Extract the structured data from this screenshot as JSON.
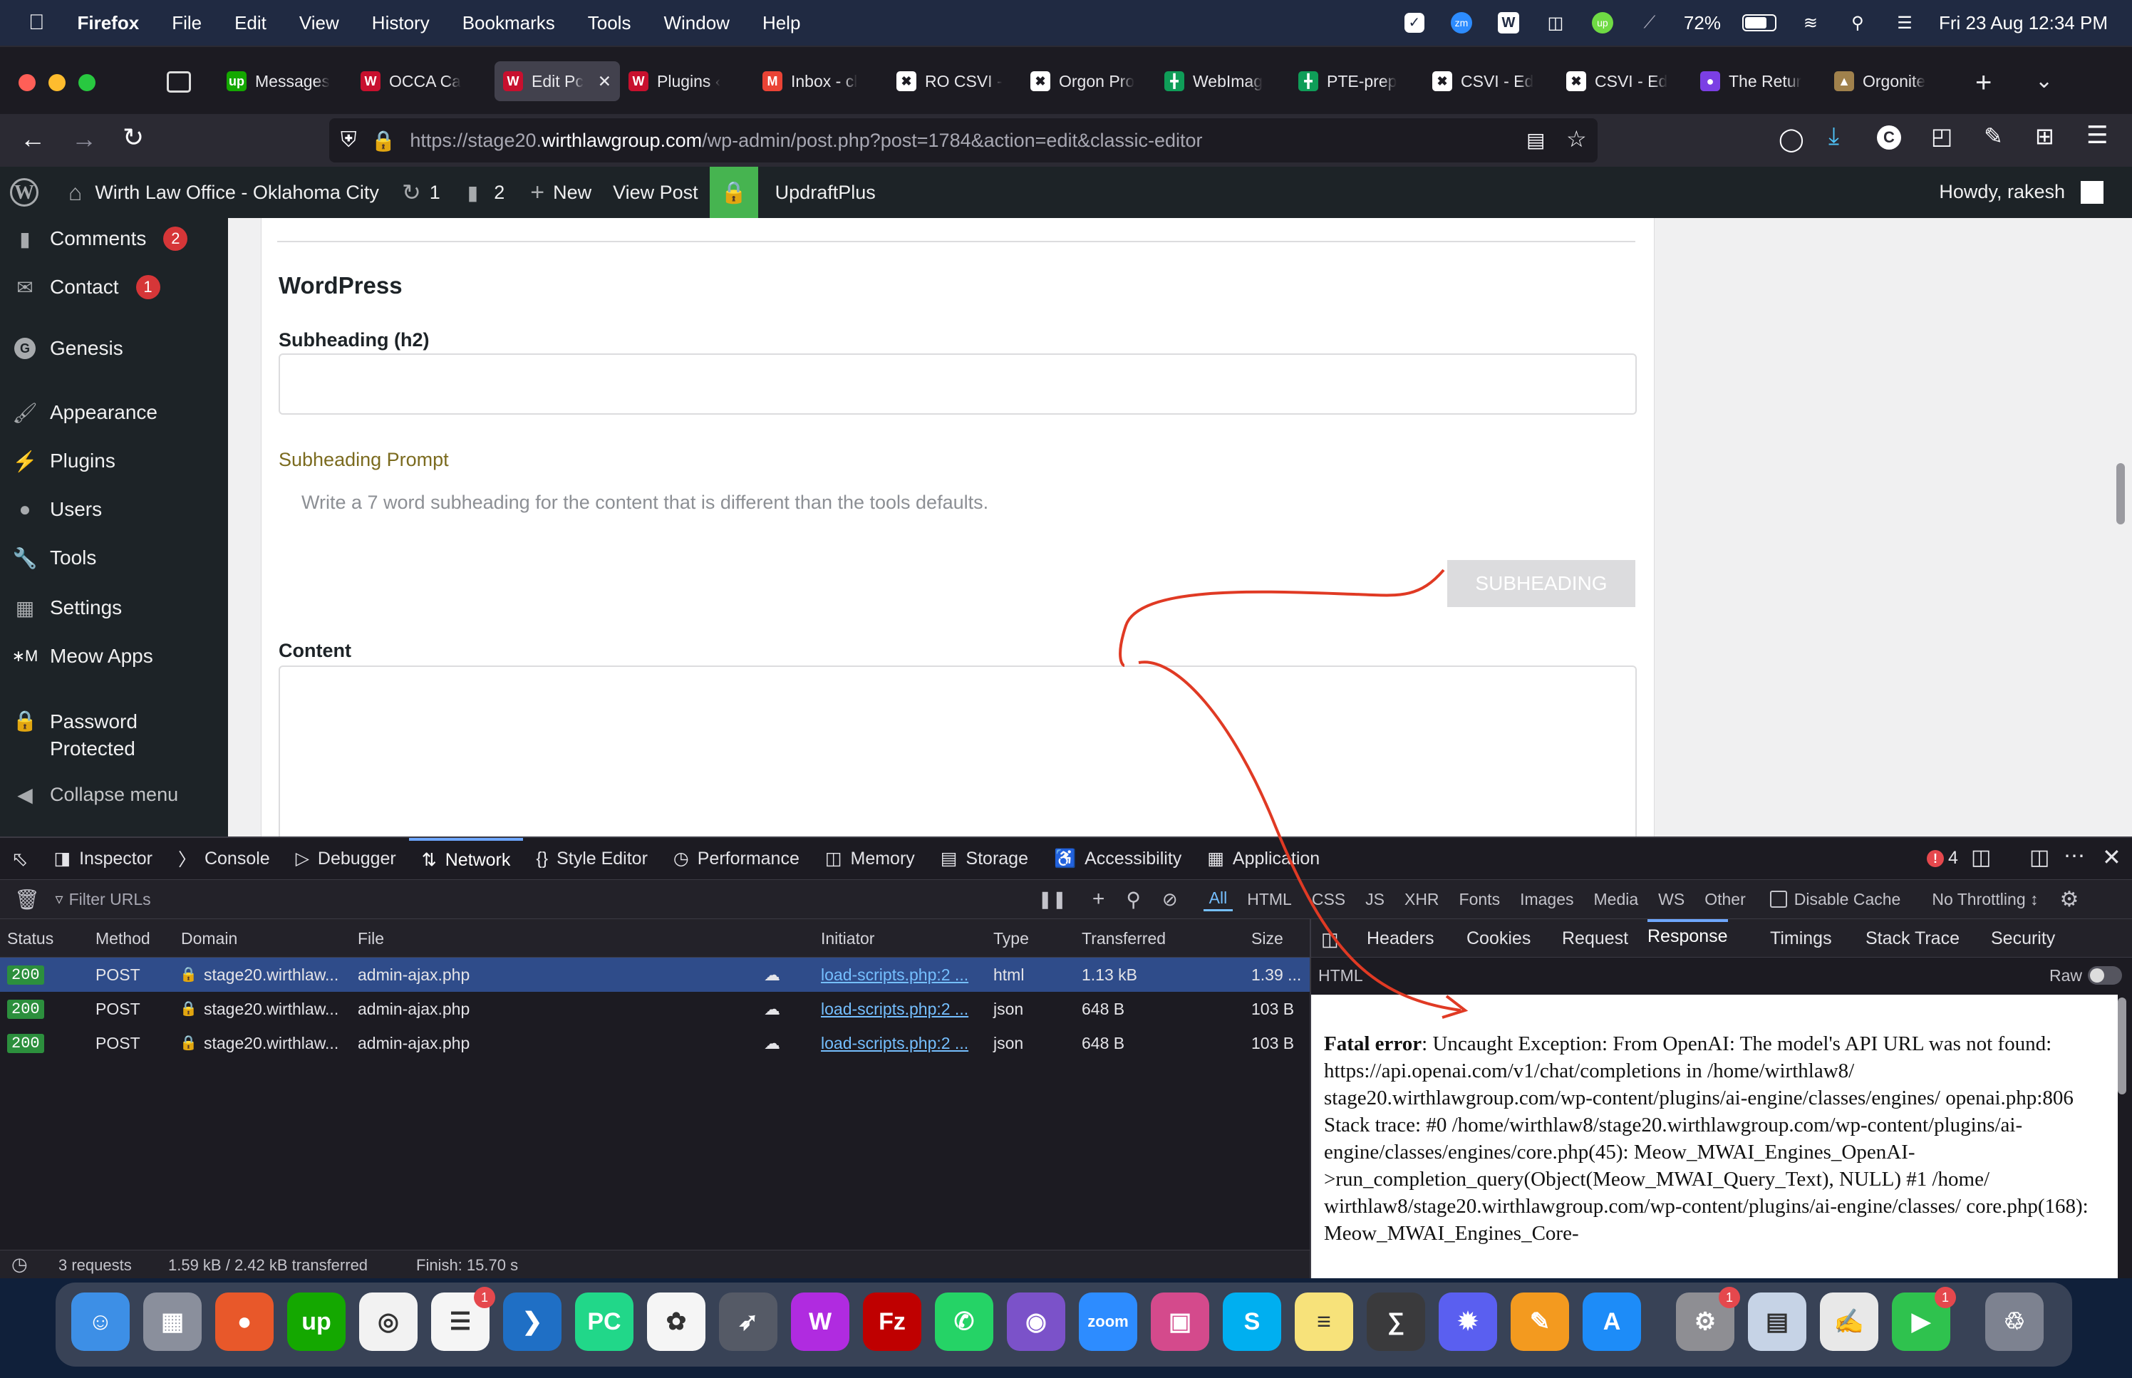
{
  "menubar": {
    "app_name": "Firefox",
    "items": [
      "File",
      "Edit",
      "View",
      "History",
      "Bookmarks",
      "Tools",
      "Window",
      "Help"
    ],
    "battery": "72%",
    "datetime": "Fri 23 Aug  12:34 PM"
  },
  "tabs": [
    {
      "label": "Messages",
      "favicon": "upwork-icon",
      "color": "#14a800",
      "glyph": "up"
    },
    {
      "label": "OCCA Ca",
      "favicon": "wirth-icon",
      "color": "#c8102e",
      "glyph": "W"
    },
    {
      "label": "Edit Pc",
      "favicon": "wirth-icon",
      "color": "#c8102e",
      "glyph": "W",
      "active": true
    },
    {
      "label": "Plugins ‹",
      "favicon": "wirth-icon",
      "color": "#c8102e",
      "glyph": "W"
    },
    {
      "label": "Inbox - cl",
      "favicon": "gmail-icon",
      "color": "#ea4335",
      "glyph": "M"
    },
    {
      "label": "RO CSVI -",
      "favicon": "joomla-icon",
      "color": "#ffffff",
      "glyph": "✖"
    },
    {
      "label": "Orgon Pro",
      "favicon": "joomla-icon",
      "color": "#ffffff",
      "glyph": "✖"
    },
    {
      "label": "WebImag",
      "favicon": "sheets-icon",
      "color": "#0f9d58",
      "glyph": "╋"
    },
    {
      "label": "PTE-prep",
      "favicon": "sheets-icon",
      "color": "#0f9d58",
      "glyph": "╋"
    },
    {
      "label": "CSVI - Ed",
      "favicon": "joomla-icon",
      "color": "#ffffff",
      "glyph": "✖"
    },
    {
      "label": "CSVI - Ed",
      "favicon": "joomla-icon",
      "color": "#ffffff",
      "glyph": "✖"
    },
    {
      "label": "The Retur",
      "favicon": "podcast-icon",
      "color": "#7b3fe4",
      "glyph": "●"
    },
    {
      "label": "Orgonite",
      "favicon": "pyramid-icon",
      "color": "#a0814c",
      "glyph": "▲"
    }
  ],
  "url": {
    "prefix": "https://stage20.",
    "host": "wirthlawgroup.com",
    "path": "/wp-admin/post.php?post=1784&action=edit&classic-editor"
  },
  "wpbar": {
    "site_name": "Wirth Law Office - Oklahoma City",
    "updates": "1",
    "comments": "2",
    "new": "New",
    "view_post": "View Post",
    "updraft": "UpdraftPlus",
    "howdy": "Howdy, rakesh"
  },
  "sidebar": {
    "items": [
      {
        "label": "Comments",
        "badge": "2",
        "icon": "comment-icon"
      },
      {
        "label": "Contact",
        "badge": "1",
        "icon": "mail-icon"
      },
      {
        "label": "Genesis",
        "badge": "",
        "icon": "genesis-icon"
      },
      {
        "label": "Appearance",
        "badge": "",
        "icon": "brush-icon"
      },
      {
        "label": "Plugins",
        "badge": "",
        "icon": "plug-icon"
      },
      {
        "label": "Users",
        "badge": "",
        "icon": "user-icon"
      },
      {
        "label": "Tools",
        "badge": "",
        "icon": "wrench-icon"
      },
      {
        "label": "Settings",
        "badge": "",
        "icon": "settings-icon"
      },
      {
        "label": "Meow Apps",
        "badge": "",
        "icon": "meow-icon"
      },
      {
        "label": "Password Protected",
        "badge": "",
        "icon": "lock-icon"
      },
      {
        "label": "Collapse menu",
        "badge": "",
        "icon": "collapse-icon"
      }
    ]
  },
  "editor": {
    "section_title": "WordPress",
    "subheading_label": "Subheading (h2)",
    "subheading_value": "",
    "prompt_label": "Subheading Prompt",
    "prompt_text": "Write a 7 word subheading for the content that is different than the tools defaults.",
    "subheading_button": "SUBHEADING",
    "content_label": "Content",
    "content_value": ""
  },
  "devtools": {
    "tabs": [
      "Inspector",
      "Console",
      "Debugger",
      "Network",
      "Style Editor",
      "Performance",
      "Memory",
      "Storage",
      "Accessibility",
      "Application"
    ],
    "active_tab": "Network",
    "error_count": "4",
    "filter_placeholder": "Filter URLs",
    "type_filters": [
      "All",
      "HTML",
      "CSS",
      "JS",
      "XHR",
      "Fonts",
      "Images",
      "Media",
      "WS",
      "Other"
    ],
    "disable_cache": "Disable Cache",
    "throttling": "No Throttling ↕",
    "columns": [
      "Status",
      "Method",
      "Domain",
      "File",
      "Initiator",
      "Type",
      "Transferred",
      "Size"
    ],
    "requests": [
      {
        "status": "200",
        "method": "POST",
        "domain": "stage20.wirthlaw...",
        "file": "admin-ajax.php",
        "initiator": "load-scripts.php:2 ...",
        "type": "html",
        "transferred": "1.13 kB",
        "size": "1.39 ..."
      },
      {
        "status": "200",
        "method": "POST",
        "domain": "stage20.wirthlaw...",
        "file": "admin-ajax.php",
        "initiator": "load-scripts.php:2 ...",
        "type": "json",
        "transferred": "648 B",
        "size": "103 B"
      },
      {
        "status": "200",
        "method": "POST",
        "domain": "stage20.wirthlaw...",
        "file": "admin-ajax.php",
        "initiator": "load-scripts.php:2 ...",
        "type": "json",
        "transferred": "648 B",
        "size": "103 B"
      }
    ],
    "summary": {
      "requests": "3 requests",
      "transferred": "1.59 kB / 2.42 kB transferred",
      "finish": "Finish: 15.70 s"
    },
    "response_tabs": [
      "Headers",
      "Cookies",
      "Request",
      "Response",
      "Timings",
      "Stack Trace",
      "Security"
    ],
    "active_response_tab": "Response",
    "response_format": "HTML",
    "raw_label": "Raw",
    "response": {
      "bold": "Fatal error",
      "text": ": Uncaught Exception: From OpenAI: The model's API URL was not found: https://api.openai.com/v1/chat/completions in /home/wirthlaw8/ stage20.wirthlawgroup.com/wp-content/plugins/ai-engine/classes/engines/ openai.php:806 Stack trace: #0 /home/wirthlaw8/stage20.wirthlawgroup.com/wp-content/plugins/ai-engine/classes/engines/core.php(45): Meow_MWAI_Engines_OpenAI- >run_completion_query(Object(Meow_MWAI_Query_Text), NULL) #1 /home/ wirthlaw8/stage20.wirthlawgroup.com/wp-content/plugins/ai-engine/classes/ core.php(168): Meow_MWAI_Engines_Core-"
    }
  },
  "dock": [
    {
      "name": "finder-icon",
      "color": "#3d8fe6",
      "glyph": "☺",
      "badge": ""
    },
    {
      "name": "launchpad-icon",
      "color": "#8a8f9c",
      "glyph": "▦",
      "badge": ""
    },
    {
      "name": "firefox-icon",
      "color": "#e8582a",
      "glyph": "●",
      "badge": ""
    },
    {
      "name": "upwork-icon",
      "color": "#14a800",
      "glyph": "up",
      "badge": ""
    },
    {
      "name": "chrome-icon",
      "color": "#f2f2f2",
      "glyph": "◎",
      "badge": ""
    },
    {
      "name": "reminders-icon",
      "color": "#f5f5f5",
      "glyph": "☰",
      "badge": "1"
    },
    {
      "name": "vscode-icon",
      "color": "#1f6fc5",
      "glyph": "❯",
      "badge": ""
    },
    {
      "name": "pycharm-icon",
      "color": "#21d789",
      "glyph": "PC",
      "badge": ""
    },
    {
      "name": "chatgpt-icon",
      "color": "#f5f5f5",
      "glyph": "✿",
      "badge": ""
    },
    {
      "name": "rocket-icon",
      "color": "#555a66",
      "glyph": "➶",
      "badge": ""
    },
    {
      "name": "wps-icon",
      "color": "#b02be0",
      "glyph": "W",
      "badge": ""
    },
    {
      "name": "filezilla-icon",
      "color": "#bf0000",
      "glyph": "Fz",
      "badge": ""
    },
    {
      "name": "whatsapp-icon",
      "color": "#25d366",
      "glyph": "✆",
      "badge": ""
    },
    {
      "name": "github-icon",
      "color": "#7b52c9",
      "glyph": "◉",
      "badge": ""
    },
    {
      "name": "zoom-icon",
      "color": "#2d8cff",
      "glyph": "zoom",
      "badge": ""
    },
    {
      "name": "photo-booth-icon",
      "color": "#d44a8c",
      "glyph": "▣",
      "badge": ""
    },
    {
      "name": "skype-icon",
      "color": "#00aff0",
      "glyph": "S",
      "badge": ""
    },
    {
      "name": "notes-icon",
      "color": "#f7e27a",
      "glyph": "≡",
      "badge": ""
    },
    {
      "name": "calculator-icon",
      "color": "#3a3a3c",
      "glyph": "∑",
      "badge": ""
    },
    {
      "name": "perplexity-icon",
      "color": "#5a5ff0",
      "glyph": "✹",
      "badge": ""
    },
    {
      "name": "pages-icon",
      "color": "#f39a1f",
      "glyph": "✎",
      "badge": ""
    },
    {
      "name": "app-store-icon",
      "color": "#1d8cf8",
      "glyph": "A",
      "badge": ""
    },
    {
      "name": "system-settings-icon",
      "color": "#8e8e93",
      "glyph": "⚙",
      "badge": "1"
    },
    {
      "name": "preview-icon",
      "color": "#c6d3e6",
      "glyph": "▤",
      "badge": ""
    },
    {
      "name": "textedit-icon",
      "color": "#e8e8e8",
      "glyph": "✍",
      "badge": ""
    },
    {
      "name": "facetime-icon",
      "color": "#2fc24e",
      "glyph": "▶",
      "badge": "1"
    },
    {
      "name": "trash-icon",
      "color": "#7d8290",
      "glyph": "♲",
      "badge": ""
    }
  ],
  "colors": {
    "accent": "#2f4c8a",
    "wp_admin": "#1d2327",
    "annotation": "#e03a24",
    "prompt_label": "#7b6b1f"
  }
}
